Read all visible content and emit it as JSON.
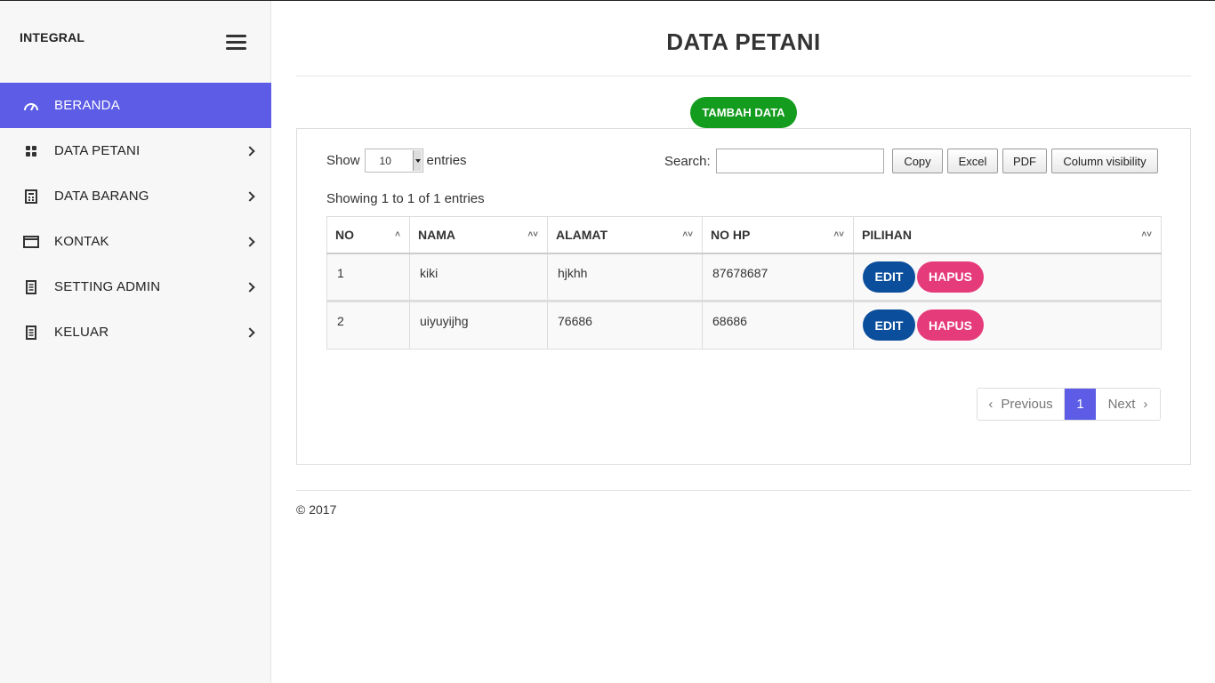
{
  "brand": "INTEGRAL",
  "sidebar": {
    "items": [
      {
        "label": "BERANDA",
        "icon": "gauge-icon",
        "active": true
      },
      {
        "label": "DATA PETANI",
        "icon": "grid-icon"
      },
      {
        "label": "DATA BARANG",
        "icon": "calculator-icon"
      },
      {
        "label": "KONTAK",
        "icon": "window-icon"
      },
      {
        "label": "SETTING ADMIN",
        "icon": "document-icon"
      },
      {
        "label": "KELUAR",
        "icon": "document-icon"
      }
    ]
  },
  "main": {
    "title": "DATA PETANI",
    "add_button": "TAMBAH DATA",
    "show_label": "Show",
    "entries_value": "10",
    "entries_label": "entries",
    "search_label": "Search:",
    "search_value": "",
    "tools": [
      "Copy",
      "Excel",
      "PDF",
      "Column visibility"
    ],
    "info": "Showing 1 to 1 of 1 entries",
    "table": {
      "headers": [
        "NO",
        "NAMA",
        "ALAMAT",
        "NO HP",
        "PILIHAN"
      ],
      "rows": [
        {
          "no": "1",
          "nama": "kiki",
          "alamat": "hjkhh",
          "nohp": "87678687"
        },
        {
          "no": "2",
          "nama": "uiyuyijhg",
          "alamat": "76686",
          "nohp": "68686"
        }
      ],
      "edit_label": "EDIT",
      "delete_label": "HAPUS"
    },
    "pagination": {
      "previous": "Previous",
      "current": "1",
      "next": "Next"
    }
  },
  "footer": "© 2017",
  "colors": {
    "accent": "#5c5ce6",
    "add": "#149c1e",
    "edit": "#0b4f9c",
    "delete": "#e63b7a"
  }
}
